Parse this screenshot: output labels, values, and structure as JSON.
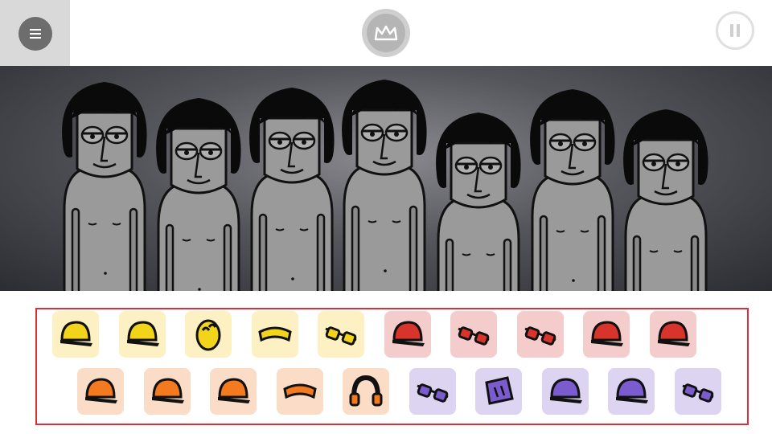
{
  "colors": {
    "menu_bg": "#d9d9d9",
    "stage_dark": "#2c2c33",
    "panel_border": "#d9303a",
    "yellow": "#f2d41b",
    "yellow_bg": "#fdf1c4",
    "red": "#d9342b",
    "red_bg": "#f5cccc",
    "orange": "#f47a1f",
    "orange_bg": "#fbdcc6",
    "purple": "#7b5ccf",
    "purple_bg": "#ddd4f1"
  },
  "toolbar": {
    "menu_icon": "menu-icon",
    "logo_icon": "crown-logo-icon",
    "pause_icon": "pause-icon"
  },
  "characters": [
    {
      "name": "performer-1",
      "state": "idle"
    },
    {
      "name": "performer-2",
      "state": "idle"
    },
    {
      "name": "performer-3",
      "state": "idle"
    },
    {
      "name": "performer-4",
      "state": "idle"
    },
    {
      "name": "performer-5",
      "state": "idle"
    },
    {
      "name": "performer-6",
      "state": "idle"
    },
    {
      "name": "performer-7",
      "state": "idle"
    }
  ],
  "sound_icons": {
    "row1": [
      {
        "group": "beats",
        "icon": "yellow-cap-icon"
      },
      {
        "group": "beats",
        "icon": "yellow-fedora-icon"
      },
      {
        "group": "beats",
        "icon": "yellow-egg-mask-icon"
      },
      {
        "group": "beats",
        "icon": "yellow-headband-icon"
      },
      {
        "group": "beats",
        "icon": "yellow-glasses-icon"
      },
      {
        "group": "effects",
        "icon": "red-cap-icon"
      },
      {
        "group": "effects",
        "icon": "red-goggles-icon"
      },
      {
        "group": "effects",
        "icon": "red-diamond-glasses-icon"
      },
      {
        "group": "effects",
        "icon": "red-beanie-icon"
      },
      {
        "group": "effects",
        "icon": "red-helmet-icon"
      }
    ],
    "row2": [
      {
        "group": "melodies",
        "icon": "orange-beanie-icon"
      },
      {
        "group": "melodies",
        "icon": "orange-cap-icon"
      },
      {
        "group": "melodies",
        "icon": "orange-beret-icon"
      },
      {
        "group": "melodies",
        "icon": "orange-visor-icon"
      },
      {
        "group": "melodies",
        "icon": "orange-headphones-icon"
      },
      {
        "group": "voices",
        "icon": "purple-sunglasses-icon"
      },
      {
        "group": "voices",
        "icon": "purple-box-hat-icon"
      },
      {
        "group": "voices",
        "icon": "purple-bowler-icon"
      },
      {
        "group": "voices",
        "icon": "purple-flat-cap-icon"
      },
      {
        "group": "voices",
        "icon": "purple-round-glasses-icon"
      }
    ]
  }
}
